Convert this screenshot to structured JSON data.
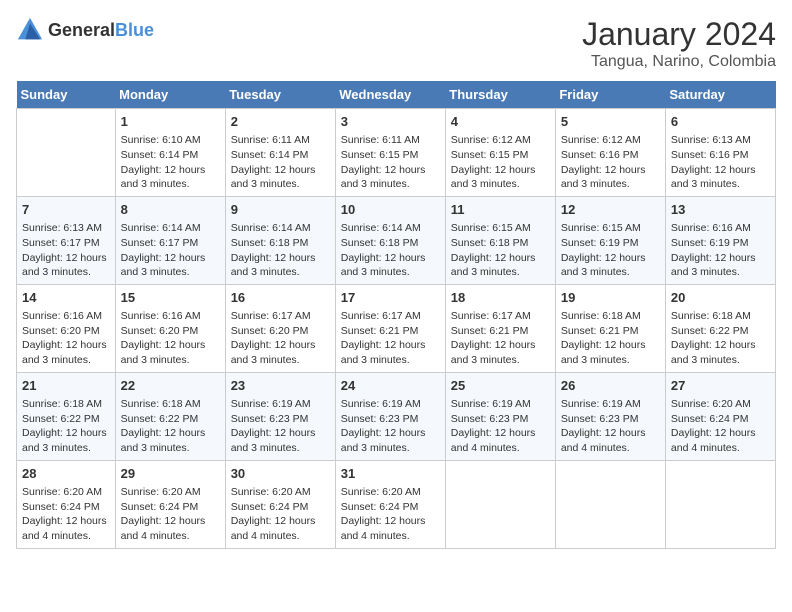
{
  "logo": {
    "general": "General",
    "blue": "Blue"
  },
  "title": "January 2024",
  "subtitle": "Tangua, Narino, Colombia",
  "days_of_week": [
    "Sunday",
    "Monday",
    "Tuesday",
    "Wednesday",
    "Thursday",
    "Friday",
    "Saturday"
  ],
  "weeks": [
    [
      {
        "day": "",
        "sunrise": "",
        "sunset": "",
        "daylight": ""
      },
      {
        "day": "1",
        "sunrise": "Sunrise: 6:10 AM",
        "sunset": "Sunset: 6:14 PM",
        "daylight": "Daylight: 12 hours and 3 minutes."
      },
      {
        "day": "2",
        "sunrise": "Sunrise: 6:11 AM",
        "sunset": "Sunset: 6:14 PM",
        "daylight": "Daylight: 12 hours and 3 minutes."
      },
      {
        "day": "3",
        "sunrise": "Sunrise: 6:11 AM",
        "sunset": "Sunset: 6:15 PM",
        "daylight": "Daylight: 12 hours and 3 minutes."
      },
      {
        "day": "4",
        "sunrise": "Sunrise: 6:12 AM",
        "sunset": "Sunset: 6:15 PM",
        "daylight": "Daylight: 12 hours and 3 minutes."
      },
      {
        "day": "5",
        "sunrise": "Sunrise: 6:12 AM",
        "sunset": "Sunset: 6:16 PM",
        "daylight": "Daylight: 12 hours and 3 minutes."
      },
      {
        "day": "6",
        "sunrise": "Sunrise: 6:13 AM",
        "sunset": "Sunset: 6:16 PM",
        "daylight": "Daylight: 12 hours and 3 minutes."
      }
    ],
    [
      {
        "day": "7",
        "sunrise": "Sunrise: 6:13 AM",
        "sunset": "Sunset: 6:17 PM",
        "daylight": "Daylight: 12 hours and 3 minutes."
      },
      {
        "day": "8",
        "sunrise": "Sunrise: 6:14 AM",
        "sunset": "Sunset: 6:17 PM",
        "daylight": "Daylight: 12 hours and 3 minutes."
      },
      {
        "day": "9",
        "sunrise": "Sunrise: 6:14 AM",
        "sunset": "Sunset: 6:18 PM",
        "daylight": "Daylight: 12 hours and 3 minutes."
      },
      {
        "day": "10",
        "sunrise": "Sunrise: 6:14 AM",
        "sunset": "Sunset: 6:18 PM",
        "daylight": "Daylight: 12 hours and 3 minutes."
      },
      {
        "day": "11",
        "sunrise": "Sunrise: 6:15 AM",
        "sunset": "Sunset: 6:18 PM",
        "daylight": "Daylight: 12 hours and 3 minutes."
      },
      {
        "day": "12",
        "sunrise": "Sunrise: 6:15 AM",
        "sunset": "Sunset: 6:19 PM",
        "daylight": "Daylight: 12 hours and 3 minutes."
      },
      {
        "day": "13",
        "sunrise": "Sunrise: 6:16 AM",
        "sunset": "Sunset: 6:19 PM",
        "daylight": "Daylight: 12 hours and 3 minutes."
      }
    ],
    [
      {
        "day": "14",
        "sunrise": "Sunrise: 6:16 AM",
        "sunset": "Sunset: 6:20 PM",
        "daylight": "Daylight: 12 hours and 3 minutes."
      },
      {
        "day": "15",
        "sunrise": "Sunrise: 6:16 AM",
        "sunset": "Sunset: 6:20 PM",
        "daylight": "Daylight: 12 hours and 3 minutes."
      },
      {
        "day": "16",
        "sunrise": "Sunrise: 6:17 AM",
        "sunset": "Sunset: 6:20 PM",
        "daylight": "Daylight: 12 hours and 3 minutes."
      },
      {
        "day": "17",
        "sunrise": "Sunrise: 6:17 AM",
        "sunset": "Sunset: 6:21 PM",
        "daylight": "Daylight: 12 hours and 3 minutes."
      },
      {
        "day": "18",
        "sunrise": "Sunrise: 6:17 AM",
        "sunset": "Sunset: 6:21 PM",
        "daylight": "Daylight: 12 hours and 3 minutes."
      },
      {
        "day": "19",
        "sunrise": "Sunrise: 6:18 AM",
        "sunset": "Sunset: 6:21 PM",
        "daylight": "Daylight: 12 hours and 3 minutes."
      },
      {
        "day": "20",
        "sunrise": "Sunrise: 6:18 AM",
        "sunset": "Sunset: 6:22 PM",
        "daylight": "Daylight: 12 hours and 3 minutes."
      }
    ],
    [
      {
        "day": "21",
        "sunrise": "Sunrise: 6:18 AM",
        "sunset": "Sunset: 6:22 PM",
        "daylight": "Daylight: 12 hours and 3 minutes."
      },
      {
        "day": "22",
        "sunrise": "Sunrise: 6:18 AM",
        "sunset": "Sunset: 6:22 PM",
        "daylight": "Daylight: 12 hours and 3 minutes."
      },
      {
        "day": "23",
        "sunrise": "Sunrise: 6:19 AM",
        "sunset": "Sunset: 6:23 PM",
        "daylight": "Daylight: 12 hours and 3 minutes."
      },
      {
        "day": "24",
        "sunrise": "Sunrise: 6:19 AM",
        "sunset": "Sunset: 6:23 PM",
        "daylight": "Daylight: 12 hours and 3 minutes."
      },
      {
        "day": "25",
        "sunrise": "Sunrise: 6:19 AM",
        "sunset": "Sunset: 6:23 PM",
        "daylight": "Daylight: 12 hours and 4 minutes."
      },
      {
        "day": "26",
        "sunrise": "Sunrise: 6:19 AM",
        "sunset": "Sunset: 6:23 PM",
        "daylight": "Daylight: 12 hours and 4 minutes."
      },
      {
        "day": "27",
        "sunrise": "Sunrise: 6:20 AM",
        "sunset": "Sunset: 6:24 PM",
        "daylight": "Daylight: 12 hours and 4 minutes."
      }
    ],
    [
      {
        "day": "28",
        "sunrise": "Sunrise: 6:20 AM",
        "sunset": "Sunset: 6:24 PM",
        "daylight": "Daylight: 12 hours and 4 minutes."
      },
      {
        "day": "29",
        "sunrise": "Sunrise: 6:20 AM",
        "sunset": "Sunset: 6:24 PM",
        "daylight": "Daylight: 12 hours and 4 minutes."
      },
      {
        "day": "30",
        "sunrise": "Sunrise: 6:20 AM",
        "sunset": "Sunset: 6:24 PM",
        "daylight": "Daylight: 12 hours and 4 minutes."
      },
      {
        "day": "31",
        "sunrise": "Sunrise: 6:20 AM",
        "sunset": "Sunset: 6:24 PM",
        "daylight": "Daylight: 12 hours and 4 minutes."
      },
      {
        "day": "",
        "sunrise": "",
        "sunset": "",
        "daylight": ""
      },
      {
        "day": "",
        "sunrise": "",
        "sunset": "",
        "daylight": ""
      },
      {
        "day": "",
        "sunrise": "",
        "sunset": "",
        "daylight": ""
      }
    ]
  ]
}
